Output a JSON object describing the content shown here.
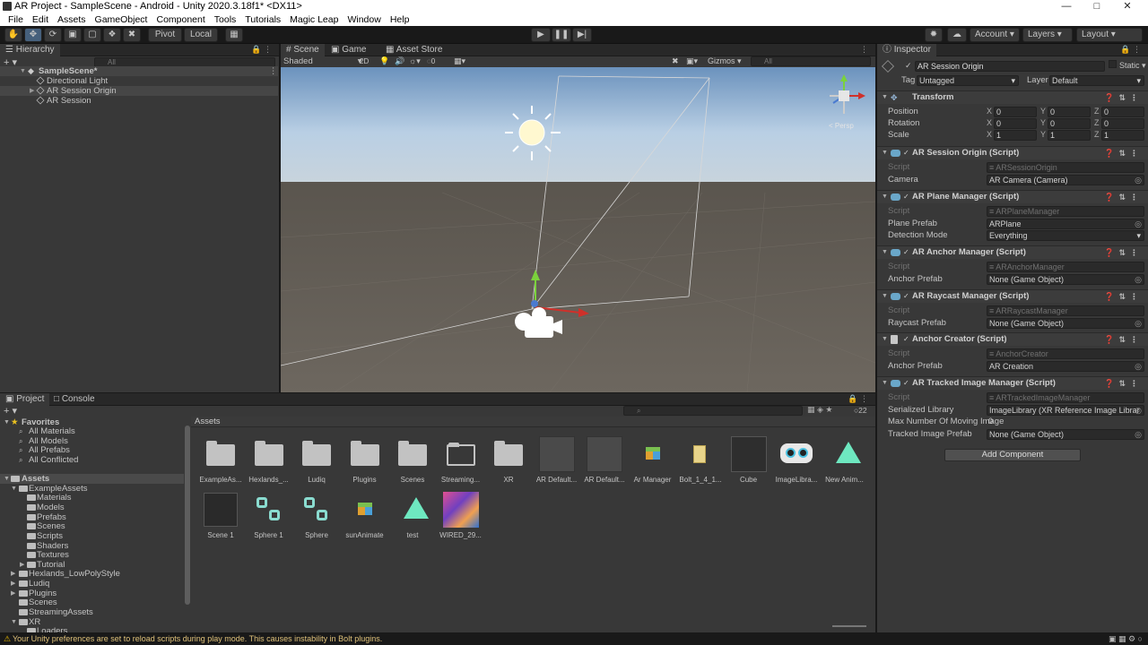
{
  "window": {
    "title": "AR Project - SampleScene - Android - Unity 2020.3.18f1* <DX11>"
  },
  "menu": [
    "File",
    "Edit",
    "Assets",
    "GameObject",
    "Component",
    "Tools",
    "Tutorials",
    "Magic Leap",
    "Window",
    "Help"
  ],
  "toolbar": {
    "pivot": "Pivot",
    "local": "Local",
    "account": "Account",
    "layers": "Layers",
    "layout": "Layout"
  },
  "hierarchy": {
    "tab": "Hierarchy",
    "search_placeholder": "All",
    "scene": "SampleScene*",
    "items": [
      "Directional Light",
      "AR Session Origin",
      "AR Session"
    ]
  },
  "scene_view": {
    "tabs": [
      "Scene",
      "Game",
      "Asset Store"
    ],
    "shading": "Shaded",
    "mode2d": "2D",
    "fx_count": "0",
    "gizmos": "Gizmos",
    "search_placeholder": "All",
    "persp": "< Persp"
  },
  "inspector": {
    "tab": "Inspector",
    "object_name": "AR Session Origin",
    "static_label": "Static",
    "tag_label": "Tag",
    "tag": "Untagged",
    "layer_label": "Layer",
    "layer": "Default",
    "transform": {
      "title": "Transform",
      "position_label": "Position",
      "rotation_label": "Rotation",
      "scale_label": "Scale",
      "axis_x": "X",
      "axis_y": "Y",
      "axis_z": "Z",
      "position": [
        "0",
        "0",
        "0"
      ],
      "rotation": [
        "0",
        "0",
        "0"
      ],
      "scale": [
        "1",
        "1",
        "1"
      ]
    },
    "script_label": "Script",
    "components": [
      {
        "title": "AR Session Origin (Script)",
        "script": "ARSessionOrigin",
        "field_label": "Camera",
        "field_value": "AR Camera (Camera)"
      },
      {
        "title": "AR Plane Manager (Script)",
        "script": "ARPlaneManager",
        "field_label": "Plane Prefab",
        "field_value": "ARPlane",
        "field2_label": "Detection Mode",
        "field2_value": "Everything"
      },
      {
        "title": "AR Anchor Manager (Script)",
        "script": "ARAnchorManager",
        "field_label": "Anchor Prefab",
        "field_value": "None (Game Object)"
      },
      {
        "title": "AR Raycast Manager (Script)",
        "script": "ARRaycastManager",
        "field_label": "Raycast Prefab",
        "field_value": "None (Game Object)"
      },
      {
        "title": "Anchor Creator (Script)",
        "script": "AnchorCreator",
        "field_label": "Anchor Prefab",
        "field_value": "AR Creation"
      },
      {
        "title": "AR Tracked Image Manager (Script)",
        "script": "ARTrackedImageManager",
        "field_label": "Serialized Library",
        "field_value": "ImageLibrary (XR Reference Image Librar",
        "field2_label": "Max Number Of Moving Image",
        "field2_value": "0",
        "field3_label": "Tracked Image Prefab",
        "field3_value": "None (Game Object)"
      }
    ],
    "add_component": "Add Component"
  },
  "project": {
    "tabs": [
      "Project",
      "Console"
    ],
    "favorites_label": "Favorites",
    "favorites": [
      "All Materials",
      "All Models",
      "All Prefabs",
      "All Conflicted"
    ],
    "assets_label": "Assets",
    "tree": [
      "ExampleAssets",
      "Materials",
      "Models",
      "Prefabs",
      "Scenes",
      "Scripts",
      "Shaders",
      "Textures",
      "Tutorial",
      "Hexlands_LowPolyStyle",
      "Ludiq",
      "Plugins",
      "Scenes",
      "StreamingAssets",
      "XR",
      "Loaders"
    ],
    "breadcrumb": "Assets",
    "hidden_count": "22",
    "assets_row1": [
      "ExampleAs...",
      "Hexlands_...",
      "Ludiq",
      "Plugins",
      "Scenes",
      "Streaming...",
      "XR",
      "AR Default...",
      "AR Default...",
      "Ar Manager",
      "Bolt_1_4_1...",
      "Cube",
      "ImageLibra...",
      "New Anim..."
    ],
    "assets_row2": [
      "Scene 1",
      "Sphere 1",
      "Sphere",
      "sunAnimate",
      "test",
      "WIRED_29..."
    ]
  },
  "status": {
    "message": "Your Unity preferences are set to reload scripts during play mode. This causes instability in Bolt plugins."
  },
  "colors": {
    "panel": "#383838",
    "toolbar": "#191919",
    "sky_top": "#6b92bd",
    "ground": "#6a645c",
    "accent": "#46607c"
  }
}
